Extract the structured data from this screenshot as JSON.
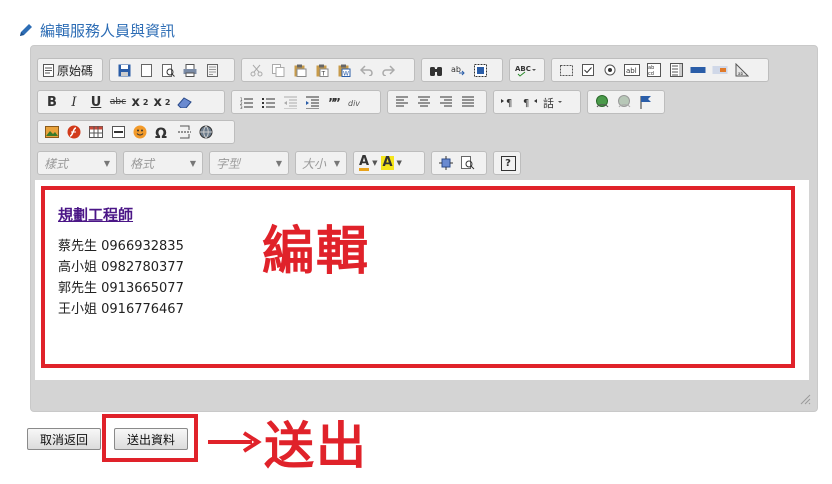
{
  "header": {
    "title": "編輯服務人員與資訊",
    "icon": "pencil-icon"
  },
  "toolbar": {
    "source_label": "原始碼",
    "format_boxes": {
      "styles_placeholder": "樣式",
      "format_placeholder": "格式",
      "font_placeholder": "字型",
      "size_placeholder": "大小"
    },
    "bold_glyph": "B",
    "italic_glyph": "I",
    "underline_glyph": "U",
    "strike_glyph": "abc",
    "subscript_glyph": "x",
    "superscript_glyph": "x",
    "font_color_glyph": "A",
    "bg_color_glyph": "A",
    "help_glyph": "?"
  },
  "content": {
    "job_title": "規劃工程師",
    "contacts": [
      "蔡先生 0966932835",
      "高小姐 0982780377",
      "郭先生 0913665077",
      "王小姐 0916776467"
    ]
  },
  "annotations": {
    "edit_label": "編輯",
    "send_label": "送出",
    "color": "#e0222a"
  },
  "actions": {
    "cancel_label": "取消返回",
    "submit_label": "送出資料"
  },
  "colors": {
    "title_blue": "#2d6db5",
    "job_title_purple": "#4b1687",
    "editor_bg": "#d4d4d4"
  }
}
